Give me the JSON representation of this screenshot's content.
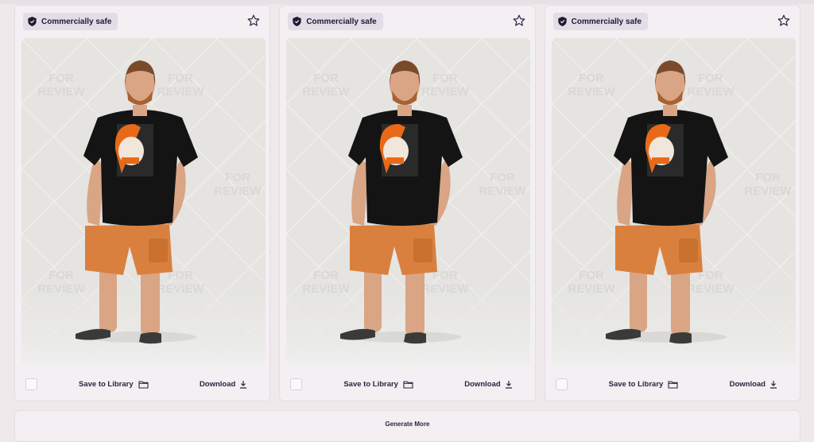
{
  "cards": [
    {
      "badge": "Commercially safe",
      "save_label": "Save to Library",
      "download_label": "Download",
      "watermark_line1": "FOR",
      "watermark_line2": "REVIEW"
    },
    {
      "badge": "Commercially safe",
      "save_label": "Save to Library",
      "download_label": "Download",
      "watermark_line1": "FOR",
      "watermark_line2": "REVIEW"
    },
    {
      "badge": "Commercially safe",
      "save_label": "Save to Library",
      "download_label": "Download",
      "watermark_line1": "FOR",
      "watermark_line2": "REVIEW"
    }
  ],
  "generate_more_label": "Generate More",
  "colors": {
    "shorts": "#d9803f",
    "shirt": "#141414",
    "skin": "#d9a585",
    "hair": "#e86a18",
    "background": "#e6e5e2"
  },
  "icons": [
    "shield-icon",
    "star-icon",
    "folder-icon",
    "download-icon"
  ]
}
